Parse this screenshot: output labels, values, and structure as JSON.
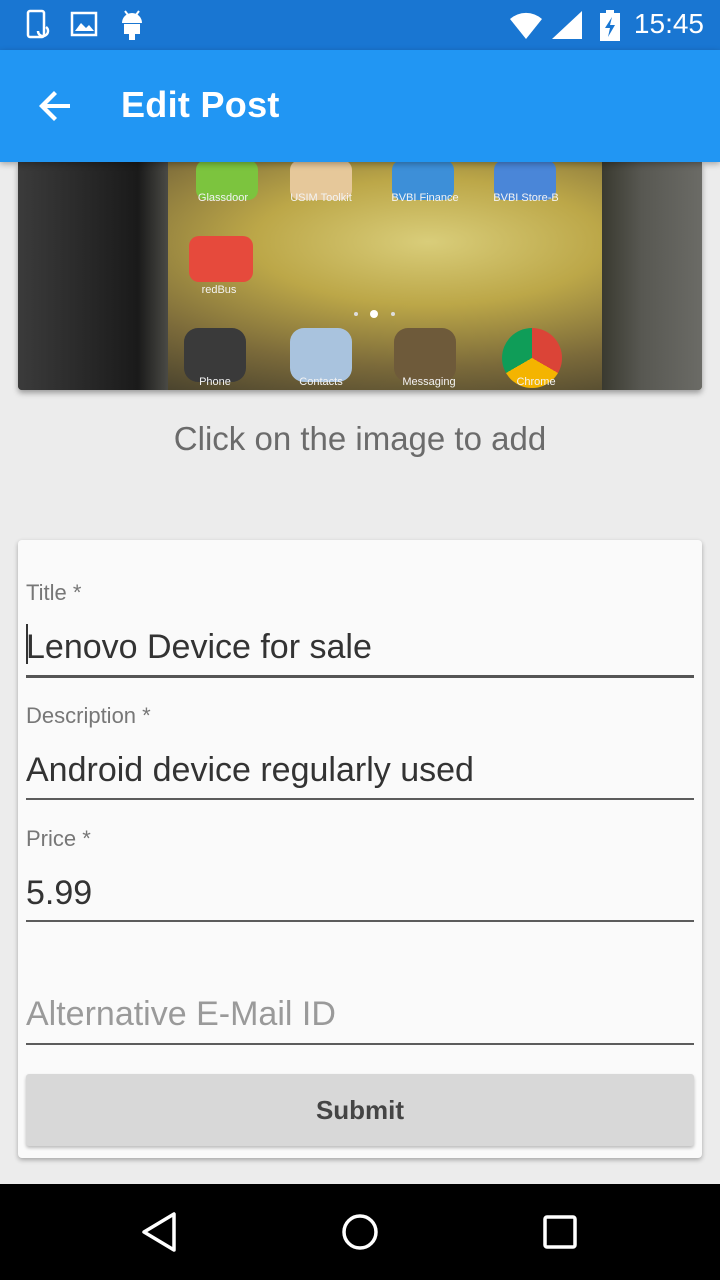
{
  "status_bar": {
    "time": "15:45",
    "icons": [
      "phone-sync-icon",
      "image-icon",
      "android-icon",
      "wifi-icon",
      "signal-icon",
      "battery-charging-icon"
    ]
  },
  "app_bar": {
    "title": "Edit Post",
    "back_icon": "arrow-back-icon"
  },
  "photo": {
    "app_labels": [
      "Glassdoor",
      "USIM Toolkit",
      "BVBI Finance",
      "BVBI Store-B",
      "redBus"
    ],
    "dock_labels": [
      "Phone",
      "Contacts",
      "Messaging",
      "Chrome"
    ]
  },
  "hint": "Click on the image to add",
  "form": {
    "title_label": "Title *",
    "title_value": "Lenovo Device for sale",
    "description_label": "Description *",
    "description_value": "Android device regularly used",
    "price_label": "Price *",
    "price_value": "5.99",
    "email_placeholder": "Alternative E-Mail ID",
    "submit_label": "Submit"
  },
  "nav_bar": {
    "icons": [
      "back-triangle-icon",
      "home-circle-icon",
      "recents-square-icon"
    ]
  }
}
